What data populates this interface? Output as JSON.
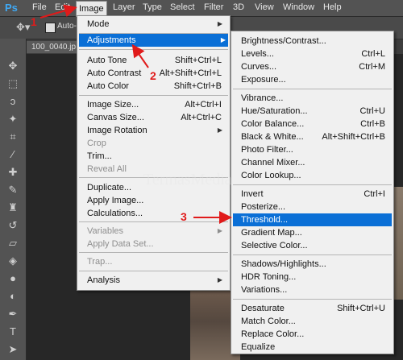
{
  "app": {
    "logo": "Ps"
  },
  "menubar": {
    "items": [
      "File",
      "Edit",
      "Image",
      "Layer",
      "Type",
      "Select",
      "Filter",
      "3D",
      "View",
      "Window",
      "Help"
    ],
    "active": "Image"
  },
  "optionbar": {
    "auto_label": "Auto-"
  },
  "document": {
    "tab_title": "100_0040.jp"
  },
  "image_menu": {
    "mode": "Mode",
    "adjustments": "Adjustments",
    "auto_tone": {
      "label": "Auto Tone",
      "shortcut": "Shift+Ctrl+L"
    },
    "auto_contrast": {
      "label": "Auto Contrast",
      "shortcut": "Alt+Shift+Ctrl+L"
    },
    "auto_color": {
      "label": "Auto Color",
      "shortcut": "Shift+Ctrl+B"
    },
    "image_size": {
      "label": "Image Size...",
      "shortcut": "Alt+Ctrl+I"
    },
    "canvas_size": {
      "label": "Canvas Size...",
      "shortcut": "Alt+Ctrl+C"
    },
    "image_rotation": "Image Rotation",
    "crop": "Crop",
    "trim": "Trim...",
    "reveal_all": "Reveal All",
    "duplicate": "Duplicate...",
    "apply_image": "Apply Image...",
    "calculations": "Calculations...",
    "variables": "Variables",
    "apply_data_set": "Apply Data Set...",
    "trap": "Trap...",
    "analysis": "Analysis"
  },
  "adjustments_menu": {
    "brightness_contrast": {
      "label": "Brightness/Contrast...",
      "shortcut": ""
    },
    "levels": {
      "label": "Levels...",
      "shortcut": "Ctrl+L"
    },
    "curves": {
      "label": "Curves...",
      "shortcut": "Ctrl+M"
    },
    "exposure": {
      "label": "Exposure...",
      "shortcut": ""
    },
    "vibrance": {
      "label": "Vibrance...",
      "shortcut": ""
    },
    "hue_saturation": {
      "label": "Hue/Saturation...",
      "shortcut": "Ctrl+U"
    },
    "color_balance": {
      "label": "Color Balance...",
      "shortcut": "Ctrl+B"
    },
    "black_white": {
      "label": "Black & White...",
      "shortcut": "Alt+Shift+Ctrl+B"
    },
    "photo_filter": {
      "label": "Photo Filter...",
      "shortcut": ""
    },
    "channel_mixer": {
      "label": "Channel Mixer...",
      "shortcut": ""
    },
    "color_lookup": {
      "label": "Color Lookup...",
      "shortcut": ""
    },
    "invert": {
      "label": "Invert",
      "shortcut": "Ctrl+I"
    },
    "posterize": {
      "label": "Posterize...",
      "shortcut": ""
    },
    "threshold": {
      "label": "Threshold...",
      "shortcut": ""
    },
    "gradient_map": {
      "label": "Gradient Map...",
      "shortcut": ""
    },
    "selective_color": {
      "label": "Selective Color...",
      "shortcut": ""
    },
    "shadows_highlights": {
      "label": "Shadows/Highlights...",
      "shortcut": ""
    },
    "hdr_toning": {
      "label": "HDR Toning...",
      "shortcut": ""
    },
    "variations": {
      "label": "Variations...",
      "shortcut": ""
    },
    "desaturate": {
      "label": "Desaturate",
      "shortcut": "Shift+Ctrl+U"
    },
    "match_color": {
      "label": "Match Color...",
      "shortcut": ""
    },
    "replace_color": {
      "label": "Replace Color...",
      "shortcut": ""
    },
    "equalize": {
      "label": "Equalize",
      "shortcut": ""
    }
  },
  "annotations": {
    "step1": "1",
    "step2": "2",
    "step3": "3"
  },
  "watermark": "TermasMedia",
  "colors": {
    "highlight": "#0a6fd6",
    "annotation": "#e01a1a",
    "menu_bg": "#f0f0f0"
  }
}
